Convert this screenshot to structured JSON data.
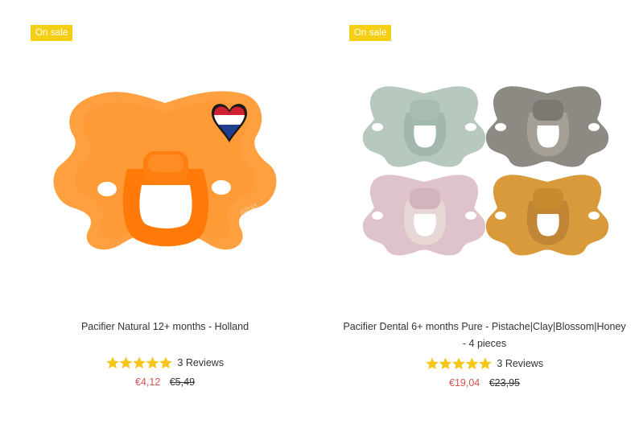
{
  "products": [
    {
      "badge": "On sale",
      "title": "Pacifier Natural 12+ months - Holland",
      "rating": 5,
      "reviews": "3 Reviews",
      "price_sale": "€4,12",
      "price_old": "€5,49",
      "image": {
        "icon": "orange-pacifier-with-dutch-flag-heart",
        "colors": {
          "main": "#ff8a1e",
          "shield": "#ffa040",
          "heart_red": "#d1202f",
          "heart_blue": "#1f3f8f"
        }
      }
    },
    {
      "badge": "On sale",
      "title": "Pacifier Dental 6+ months Pure - Pistache|Clay|Blossom|Honey - 4 pieces",
      "rating": 5,
      "reviews": "3 Reviews",
      "price_sale": "€19,04",
      "price_old": "€23,95",
      "image": {
        "icon": "four-pacifiers",
        "colors": {
          "pistache": "#b7c9bf",
          "clay": "#8d8a84",
          "blossom": "#dfc3ca",
          "honey": "#d99a3c"
        }
      }
    }
  ],
  "colors": {
    "badge_bg": "#f5cf14",
    "badge_text": "#ffffff",
    "star": "#f5c518",
    "sale_price": "#d9534f"
  }
}
